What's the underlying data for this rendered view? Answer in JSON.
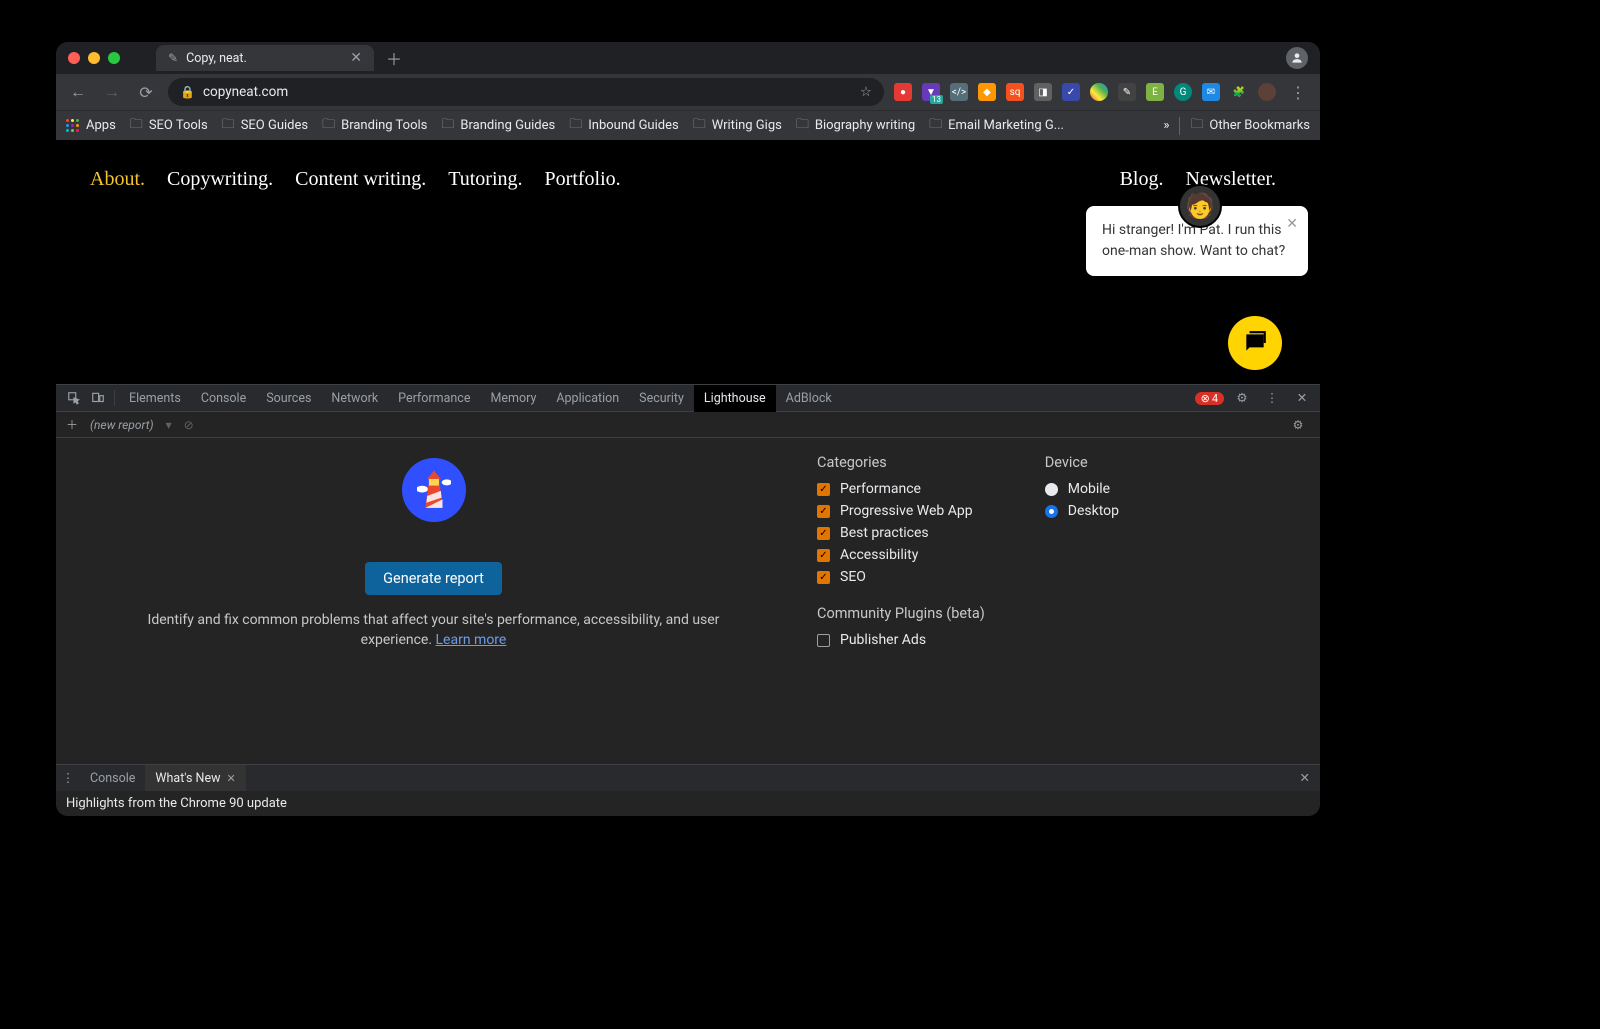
{
  "tab": {
    "title": "Copy, neat."
  },
  "url": "copyneat.com",
  "bookmarks": {
    "apps": "Apps",
    "items": [
      "SEO Tools",
      "SEO Guides",
      "Branding Tools",
      "Branding Guides",
      "Inbound Guides",
      "Writing Gigs",
      "Biography writing",
      "Email Marketing G..."
    ],
    "overflow": "»",
    "other": "Other Bookmarks"
  },
  "siteNav": {
    "left": [
      "About.",
      "Copywriting.",
      "Content writing.",
      "Tutoring.",
      "Portfolio."
    ],
    "right": [
      "Blog.",
      "Newsletter."
    ]
  },
  "chat": {
    "text": "Hi stranger! I'm Pat. I run this one-man show. Want to chat?"
  },
  "devtools": {
    "tabs": [
      "Elements",
      "Console",
      "Sources",
      "Network",
      "Performance",
      "Memory",
      "Application",
      "Security",
      "Lighthouse",
      "AdBlock"
    ],
    "errors": "4",
    "newReport": "(new report)",
    "lighthouse": {
      "button": "Generate report",
      "desc": "Identify and fix common problems that affect your site's performance, accessibility, and user experience. ",
      "learnMore": "Learn more",
      "categoriesLabel": "Categories",
      "categories": [
        "Performance",
        "Progressive Web App",
        "Best practices",
        "Accessibility",
        "SEO"
      ],
      "pluginsLabel": "Community Plugins (beta)",
      "plugins": [
        "Publisher Ads"
      ],
      "deviceLabel": "Device",
      "devices": [
        "Mobile",
        "Desktop"
      ]
    },
    "drawer": {
      "tabs": [
        "Console",
        "What's New"
      ],
      "content": "Highlights from the Chrome 90 update"
    }
  }
}
